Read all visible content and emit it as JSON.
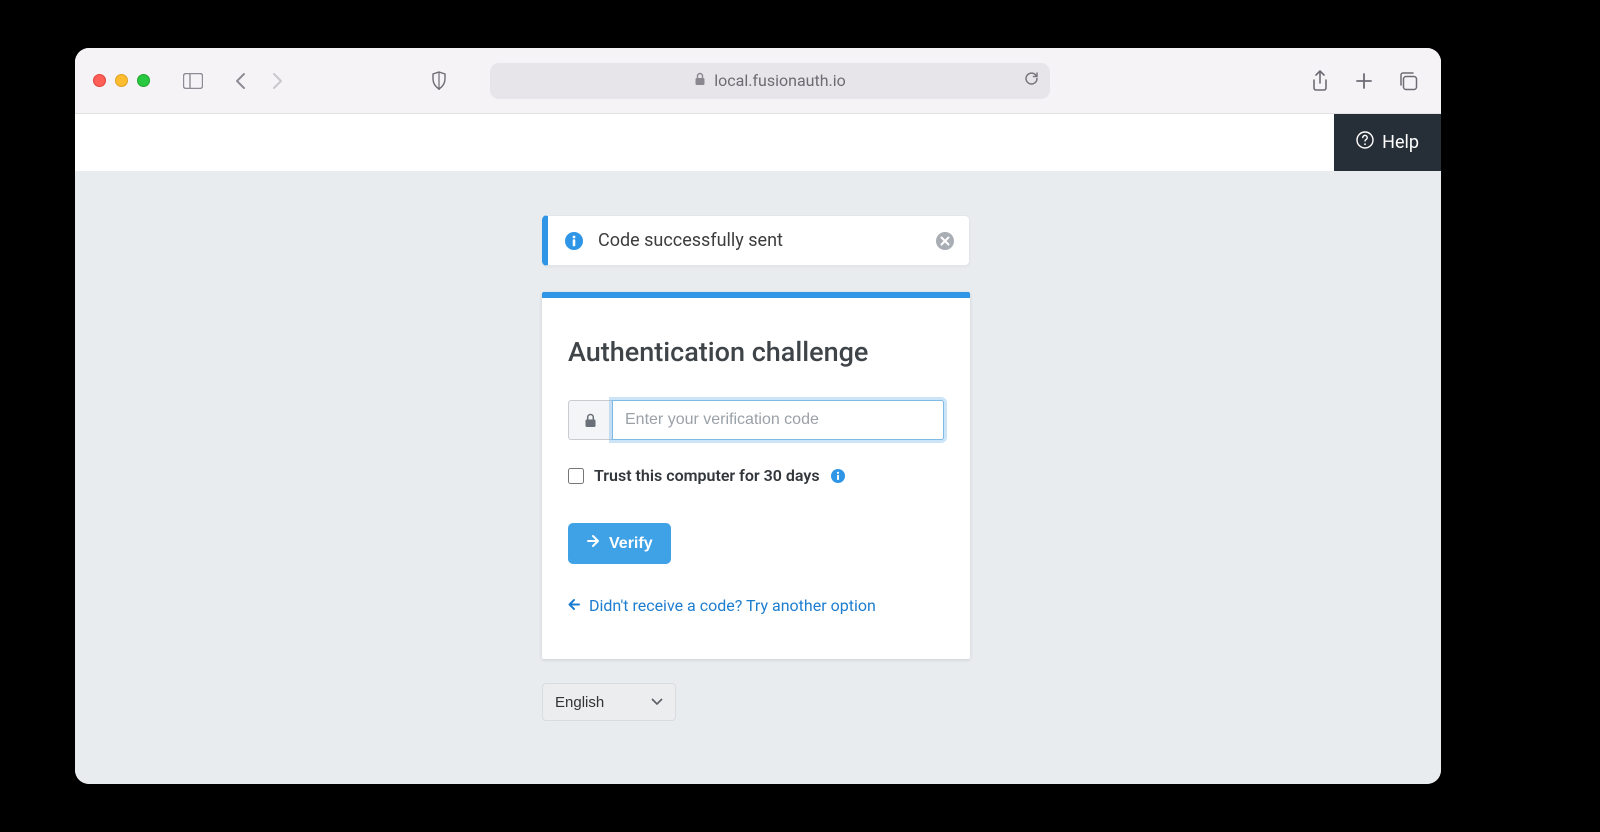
{
  "browser": {
    "address": "local.fusionauth.io"
  },
  "header": {
    "help_label": "Help"
  },
  "alert": {
    "message": "Code successfully sent"
  },
  "panel": {
    "title": "Authentication challenge",
    "code_placeholder": "Enter your verification code",
    "trust_label": "Trust this computer for 30 days",
    "verify_label": "Verify",
    "alt_link": "Didn't receive a code? Try another option"
  },
  "language": {
    "selected": "English"
  }
}
